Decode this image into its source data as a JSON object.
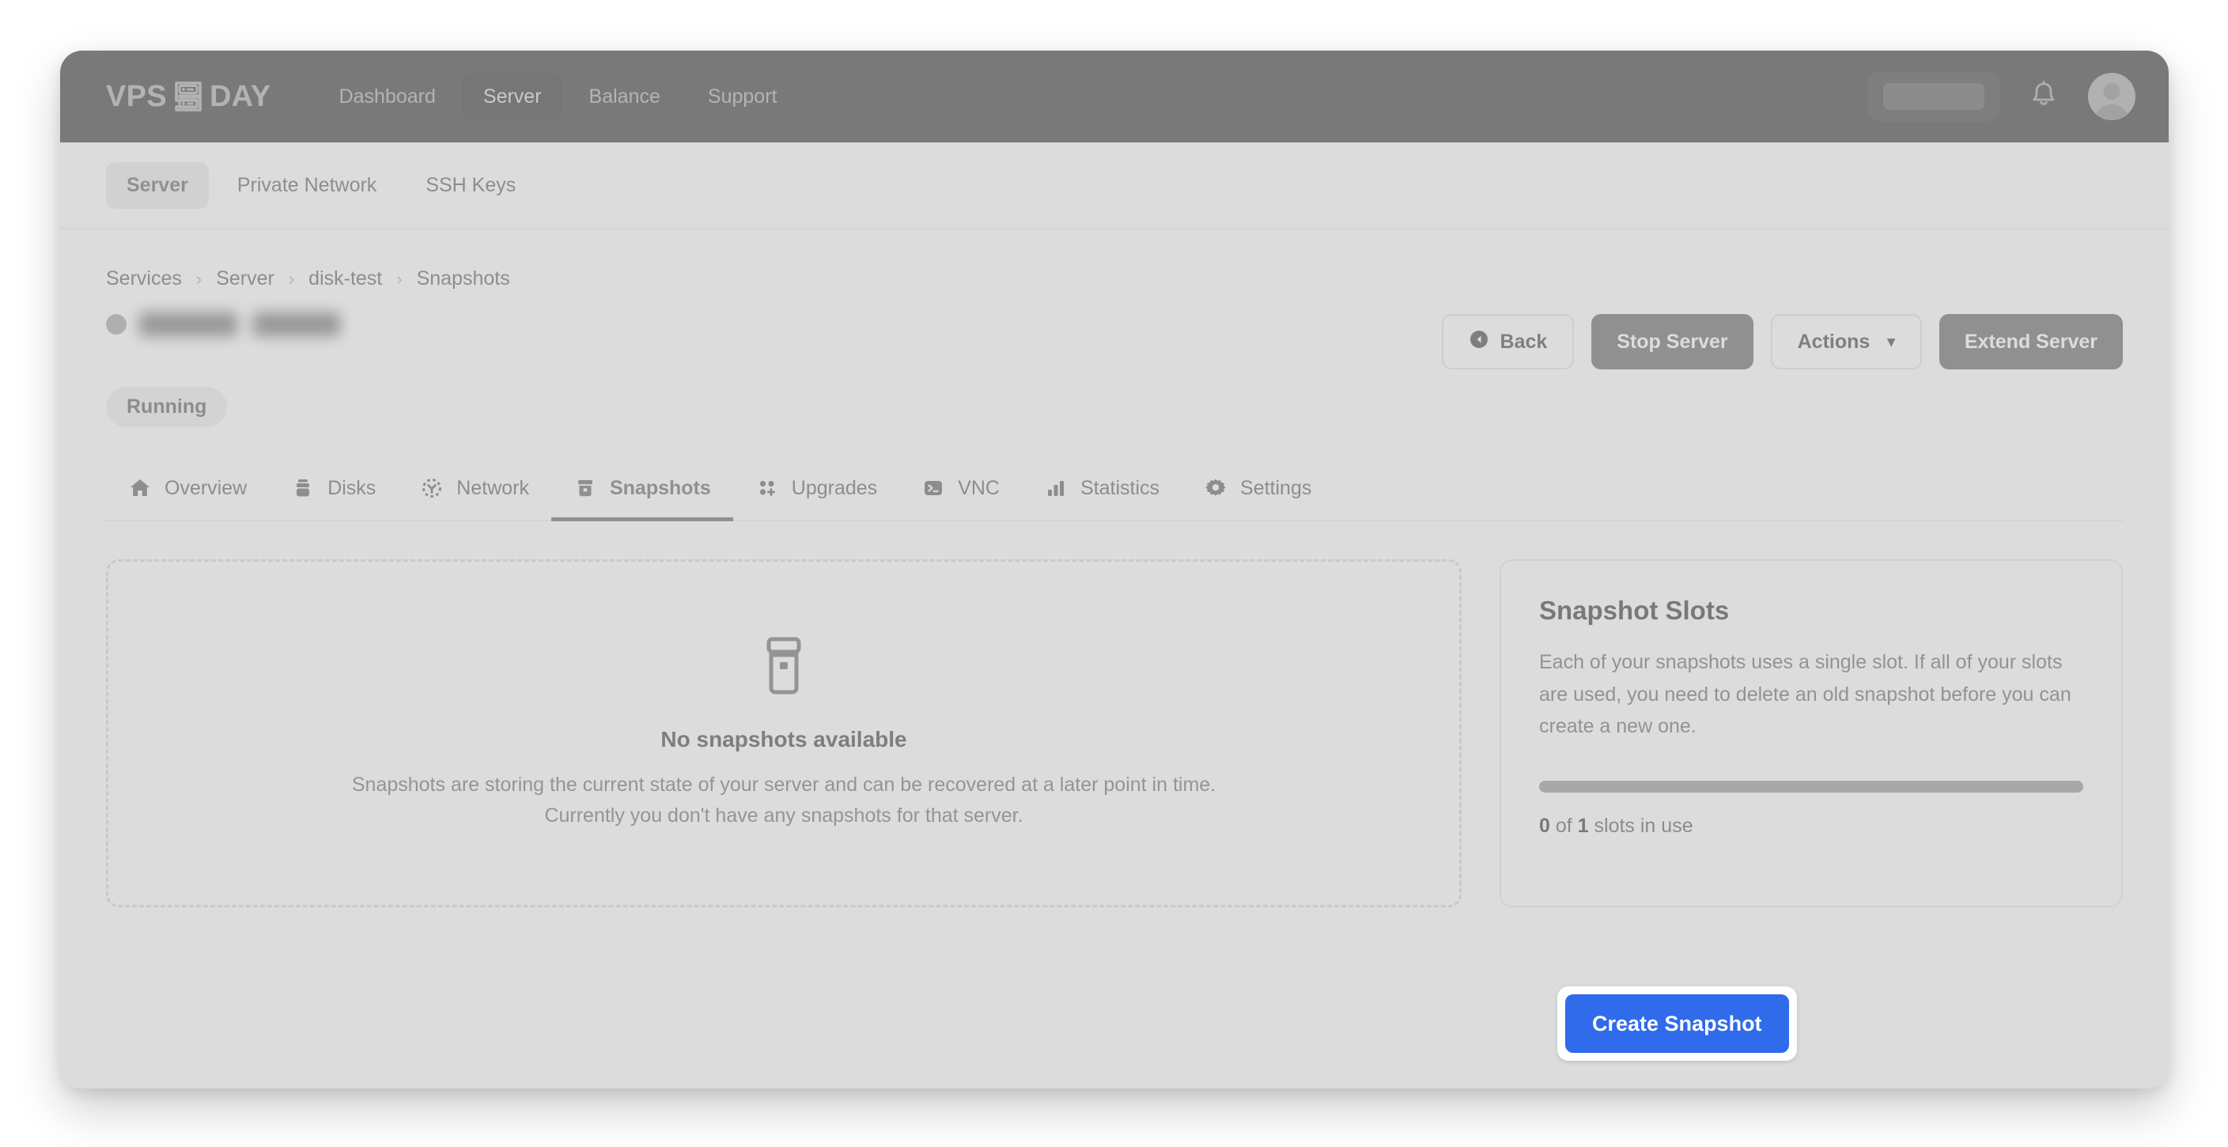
{
  "brand": {
    "name_left": "VPS",
    "name_right": "DAY",
    "logo_icon": "server-rack-icon"
  },
  "topnav": {
    "items": [
      {
        "label": "Dashboard",
        "active": false
      },
      {
        "label": "Server",
        "active": true
      },
      {
        "label": "Balance",
        "active": false
      },
      {
        "label": "Support",
        "active": false
      }
    ],
    "balance_pill": "",
    "notifications_icon": "bell-icon",
    "avatar_icon": "user-avatar-icon"
  },
  "subnav": {
    "items": [
      {
        "label": "Server",
        "active": true
      },
      {
        "label": "Private Network",
        "active": false
      },
      {
        "label": "SSH Keys",
        "active": false
      }
    ]
  },
  "breadcrumb": {
    "items": [
      "Services",
      "Server",
      "disk-test",
      "Snapshots"
    ],
    "separator": "›"
  },
  "server": {
    "name": "",
    "status": "Running",
    "status_dot_color": "#6aa583"
  },
  "actions": {
    "back": "Back",
    "back_icon": "back-circle-arrow-icon",
    "stop_server": "Stop Server",
    "more": "Actions",
    "more_icon": "chevron-down-icon",
    "extend_server": "Extend Server"
  },
  "tabs": [
    {
      "label": "Overview",
      "icon": "home-icon",
      "active": false
    },
    {
      "label": "Disks",
      "icon": "disk-icon",
      "active": false
    },
    {
      "label": "Network",
      "icon": "network-icon",
      "active": false
    },
    {
      "label": "Snapshots",
      "icon": "archive-icon",
      "active": true
    },
    {
      "label": "Upgrades",
      "icon": "grid-plus-icon",
      "active": false
    },
    {
      "label": "VNC",
      "icon": "terminal-icon",
      "active": false
    },
    {
      "label": "Statistics",
      "icon": "bar-chart-icon",
      "active": false
    },
    {
      "label": "Settings",
      "icon": "gear-icon",
      "active": false
    }
  ],
  "empty_state": {
    "icon": "archive-box-icon",
    "title": "No snapshots available",
    "line1": "Snapshots are storing the current state of your server and can be recovered at a later point in time.",
    "line2": "Currently you don't have any snapshots for that server."
  },
  "slots_panel": {
    "title": "Snapshot Slots",
    "description": "Each of your snapshots uses a single slot. If all of your slots are used, you need to delete an old snapshot before you can create a new one.",
    "usage_used": "0",
    "usage_of": "of",
    "usage_total": "1",
    "usage_suffix": "slots in use",
    "progress_percent": 0,
    "progress_track_color": "#6e86ae"
  },
  "create_button": {
    "label": "Create Snapshot",
    "color": "#2f6bea",
    "focused": true
  }
}
